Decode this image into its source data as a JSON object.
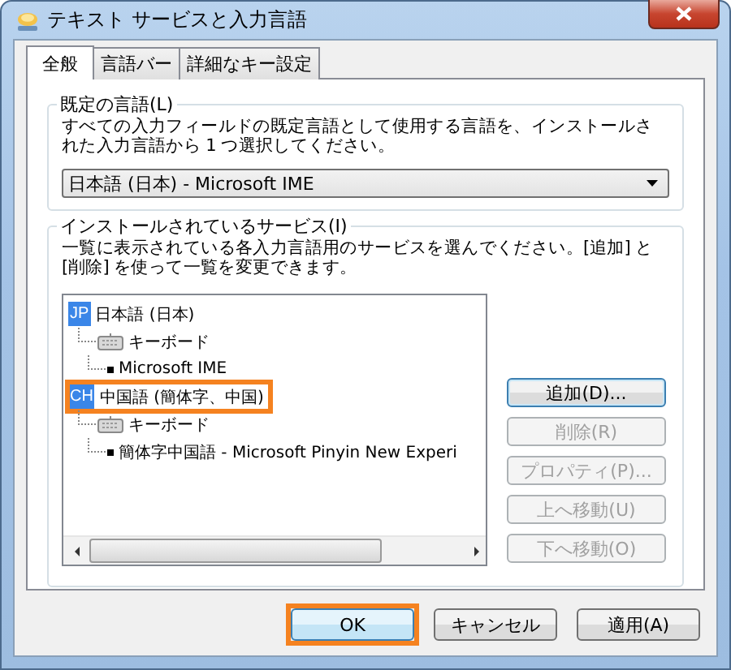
{
  "window": {
    "title": "テキスト サービスと入力言語"
  },
  "tabs": [
    {
      "label": "全般",
      "selected": true
    },
    {
      "label": "言語バー",
      "selected": false
    },
    {
      "label": "詳細なキー設定",
      "selected": false
    }
  ],
  "default_language": {
    "legend": "既定の言語(L)",
    "description": "すべての入力フィールドの既定言語として使用する言語を、インストールされた入力言語から 1 つ選択してください。",
    "dropdown": {
      "value": "日本語 (日本) - Microsoft IME"
    }
  },
  "installed_services": {
    "legend": "インストールされているサービス(I)",
    "description": "一覧に表示されている各入力言語用のサービスを選んでください。[追加] と [削除] を使って一覧を変更できます。",
    "tree": [
      {
        "kind": "language",
        "badge": "JP",
        "label": "日本語 (日本)",
        "highlighted": false,
        "children": [
          {
            "kind": "category",
            "label": "キーボード",
            "children": [
              {
                "kind": "service",
                "label": "Microsoft IME"
              }
            ]
          }
        ]
      },
      {
        "kind": "language",
        "badge": "CH",
        "label": "中国語 (簡体字、中国)",
        "highlighted": true,
        "children": [
          {
            "kind": "category",
            "label": "キーボード",
            "children": [
              {
                "kind": "service",
                "label": "簡体字中国語 - Microsoft Pinyin New Experi"
              }
            ]
          }
        ]
      }
    ],
    "buttons": [
      {
        "label": "追加(D)...",
        "disabled": false,
        "focused": true
      },
      {
        "label": "削除(R)",
        "disabled": true,
        "focused": false
      },
      {
        "label": "プロパティ(P)...",
        "disabled": true,
        "focused": false
      },
      {
        "label": "上へ移動(U)",
        "disabled": true,
        "focused": false
      },
      {
        "label": "下へ移動(O)",
        "disabled": true,
        "focused": false
      }
    ]
  },
  "footer_buttons": [
    {
      "label": "OK",
      "disabled": false,
      "focused": true,
      "highlighted": true
    },
    {
      "label": "キャンセル",
      "disabled": false,
      "focused": false,
      "highlighted": false
    },
    {
      "label": "適用(A)",
      "disabled": false,
      "focused": false,
      "highlighted": false
    }
  ]
}
